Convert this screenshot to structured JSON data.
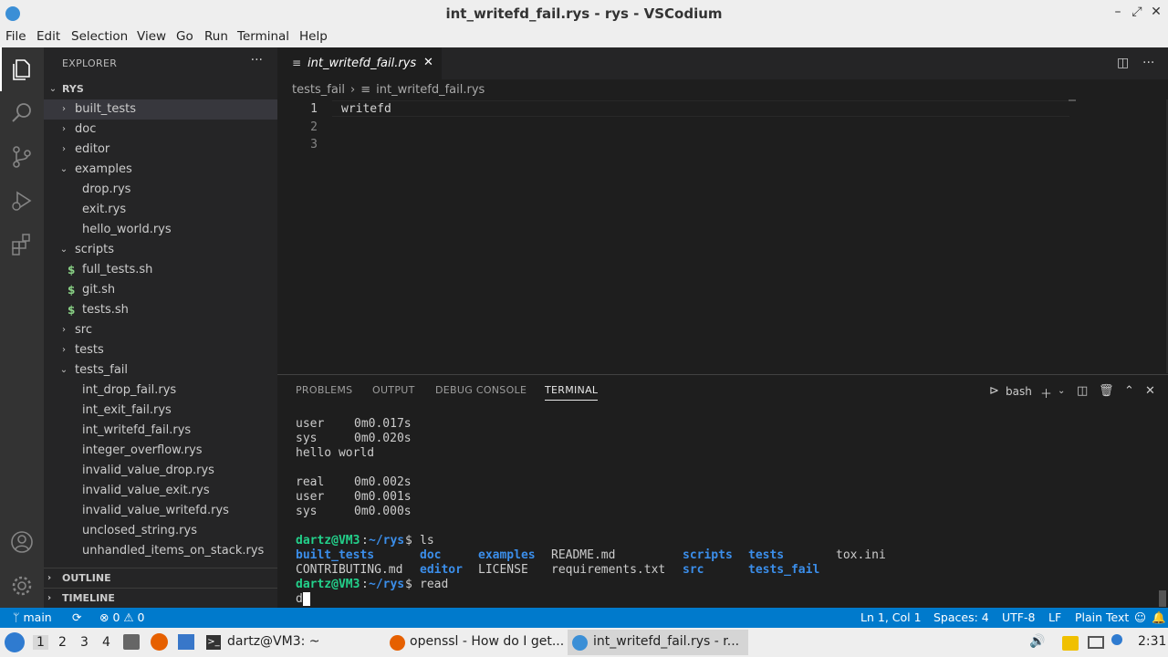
{
  "window": {
    "title": "int_writefd_fail.rys - rys - VSCodium",
    "controls": [
      "–",
      "⤢",
      "✕"
    ]
  },
  "menu": [
    "File",
    "Edit",
    "Selection",
    "View",
    "Go",
    "Run",
    "Terminal",
    "Help"
  ],
  "sidebar": {
    "header": "EXPLORER",
    "more": "···",
    "root": "RYS",
    "tree": [
      {
        "label": "built_tests",
        "kind": "folder",
        "open": false,
        "depth": 1
      },
      {
        "label": "doc",
        "kind": "folder",
        "open": false,
        "depth": 1
      },
      {
        "label": "editor",
        "kind": "folder",
        "open": false,
        "depth": 1
      },
      {
        "label": "examples",
        "kind": "folder",
        "open": true,
        "depth": 1
      },
      {
        "label": "drop.rys",
        "kind": "file",
        "depth": 2
      },
      {
        "label": "exit.rys",
        "kind": "file",
        "depth": 2
      },
      {
        "label": "hello_world.rys",
        "kind": "file",
        "depth": 2
      },
      {
        "label": "scripts",
        "kind": "folder",
        "open": true,
        "depth": 1
      },
      {
        "label": "full_tests.sh",
        "kind": "sh",
        "depth": 2
      },
      {
        "label": "git.sh",
        "kind": "sh",
        "depth": 2
      },
      {
        "label": "tests.sh",
        "kind": "sh",
        "depth": 2
      },
      {
        "label": "src",
        "kind": "folder",
        "open": false,
        "depth": 1
      },
      {
        "label": "tests",
        "kind": "folder",
        "open": false,
        "depth": 1
      },
      {
        "label": "tests_fail",
        "kind": "folder",
        "open": true,
        "depth": 1
      },
      {
        "label": "int_drop_fail.rys",
        "kind": "file",
        "depth": 2
      },
      {
        "label": "int_exit_fail.rys",
        "kind": "file",
        "depth": 2
      },
      {
        "label": "int_writefd_fail.rys",
        "kind": "file",
        "depth": 2
      },
      {
        "label": "integer_overflow.rys",
        "kind": "file",
        "depth": 2
      },
      {
        "label": "invalid_value_drop.rys",
        "kind": "file",
        "depth": 2
      },
      {
        "label": "invalid_value_exit.rys",
        "kind": "file",
        "depth": 2
      },
      {
        "label": "invalid_value_writefd.rys",
        "kind": "file",
        "depth": 2
      },
      {
        "label": "unclosed_string.rys",
        "kind": "file",
        "depth": 2
      },
      {
        "label": "unhandled_items_on_stack.rys",
        "kind": "file",
        "depth": 2
      }
    ],
    "outline": "OUTLINE",
    "timeline": "TIMELINE"
  },
  "editor": {
    "tab_label": "int_writefd_fail.rys",
    "tab_close": "✕",
    "breadcrumb": [
      "tests_fail",
      "›",
      "≡",
      "int_writefd_fail.rys"
    ],
    "lines": [
      {
        "num": "1",
        "text": "writefd"
      },
      {
        "num": "2",
        "text": ""
      },
      {
        "num": "3",
        "text": ""
      }
    ]
  },
  "panel": {
    "tabs": [
      "PROBLEMS",
      "OUTPUT",
      "DEBUG CONSOLE",
      "TERMINAL"
    ],
    "active_tab": "TERMINAL",
    "shell": "bash",
    "terminal": {
      "lines_top": [
        [
          "user",
          "0m0.017s"
        ],
        [
          "sys",
          "0m0.020s"
        ]
      ],
      "hello": "hello world",
      "lines_mid": [
        [
          "real",
          "0m0.002s"
        ],
        [
          "user",
          "0m0.001s"
        ],
        [
          "sys",
          "0m0.000s"
        ]
      ],
      "prompt_user": "dartz@VM3",
      "prompt_sep": ":",
      "prompt_path": "~/rys",
      "prompt_end": "$ ",
      "cmd1": "ls",
      "ls_row1": [
        {
          "t": "built_tests",
          "dir": true
        },
        {
          "t": "doc",
          "dir": true
        },
        {
          "t": "examples",
          "dir": true
        },
        {
          "t": "README.md",
          "dir": false
        },
        {
          "t": "scripts",
          "dir": true
        },
        {
          "t": "tests",
          "dir": true
        },
        {
          "t": "tox.ini",
          "dir": false
        }
      ],
      "ls_row2": [
        {
          "t": "CONTRIBUTING.md",
          "dir": false
        },
        {
          "t": "editor",
          "dir": true
        },
        {
          "t": "LICENSE",
          "dir": false
        },
        {
          "t": "requirements.txt",
          "dir": false
        },
        {
          "t": "src",
          "dir": true
        },
        {
          "t": "tests_fail",
          "dir": true
        }
      ],
      "cmd2": "read",
      "input": "d"
    }
  },
  "status": {
    "branch": "main",
    "sync": "⟳",
    "problems": "⊗ 0 ⚠ 0",
    "position": "Ln 1, Col 1",
    "spaces": "Spaces: 4",
    "encoding": "UTF-8",
    "eol": "LF",
    "language": "Plain Text"
  },
  "taskbar": {
    "workspaces": [
      "1",
      "2",
      "3",
      "4"
    ],
    "tasks": [
      "dartz@VM3: ~",
      "openssl - How do I get...",
      "int_writefd_fail.rys - r..."
    ],
    "clock": "2:31"
  },
  "colors": {
    "accent": "#007acc",
    "folder_blue": "#3b8eea",
    "prompt_green": "#23d18b",
    "sh_green": "#89d185"
  }
}
